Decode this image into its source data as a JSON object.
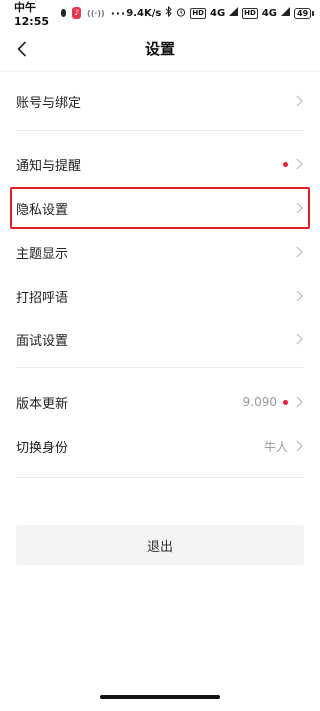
{
  "status_bar": {
    "time": "中午12:55",
    "app_badge": "♪",
    "net_speed": "9.4K/s",
    "hd1": "HD",
    "signal1": "4G",
    "hd2": "HD",
    "signal2": "4G",
    "battery": "49"
  },
  "header": {
    "title": "设置",
    "back_icon": "chevron-left-icon"
  },
  "menu": {
    "account": {
      "label": "账号与绑定"
    },
    "notify": {
      "label": "通知与提醒",
      "has_dot": true
    },
    "privacy": {
      "label": "隐私设置"
    },
    "theme": {
      "label": "主题显示"
    },
    "greeting": {
      "label": "打招呼语"
    },
    "interview": {
      "label": "面试设置"
    },
    "version": {
      "label": "版本更新",
      "value": "9.090",
      "has_dot": true
    },
    "identity": {
      "label": "切换身份",
      "value": "牛人"
    }
  },
  "logout": {
    "label": "退出"
  },
  "colors": {
    "accent_red": "#e8203a",
    "highlight": "#e02020",
    "divider": "#ececec"
  }
}
